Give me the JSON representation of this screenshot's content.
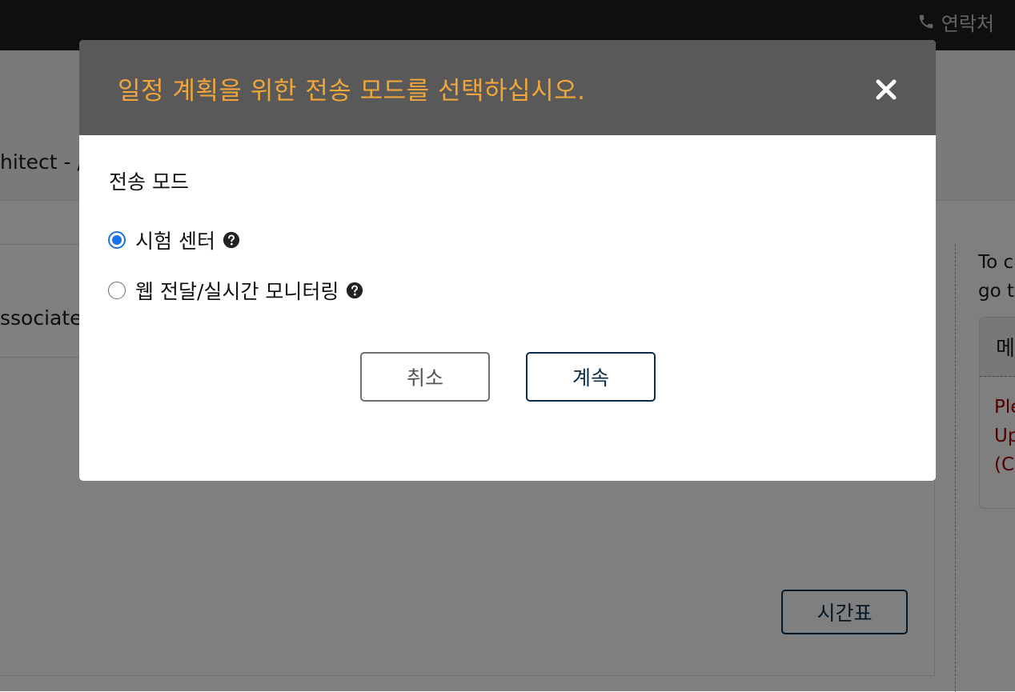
{
  "topbar": {
    "contact_label": "연락처",
    "contact_icon": "phone-icon"
  },
  "background": {
    "exam_title": "hitect - /",
    "exam_subtitle": "ssociate",
    "schedule_button_label": "시간표",
    "right_text_line1": "To c",
    "right_text_line2": "go t",
    "right_panel_heading": "메",
    "right_panel_message": [
      "Ple",
      "Up",
      "(Co"
    ]
  },
  "modal": {
    "title": "일정 계획을 위한 전송 모드를 선택하십시오.",
    "close_icon": "close-icon",
    "section_label": "전송 모드",
    "options": [
      {
        "label": "시험 센터",
        "selected": true,
        "help_icon": "question-circle-icon"
      },
      {
        "label": "웹 전달/실시간 모니터링",
        "selected": false,
        "help_icon": "question-circle-icon"
      }
    ],
    "cancel_label": "취소",
    "continue_label": "계속"
  },
  "colors": {
    "modal_title": "#f0a63a",
    "modal_header_bg": "#595959",
    "radio_selected": "#1a73e8",
    "primary_border": "#0b2d4a",
    "error_text": "#a00000"
  }
}
